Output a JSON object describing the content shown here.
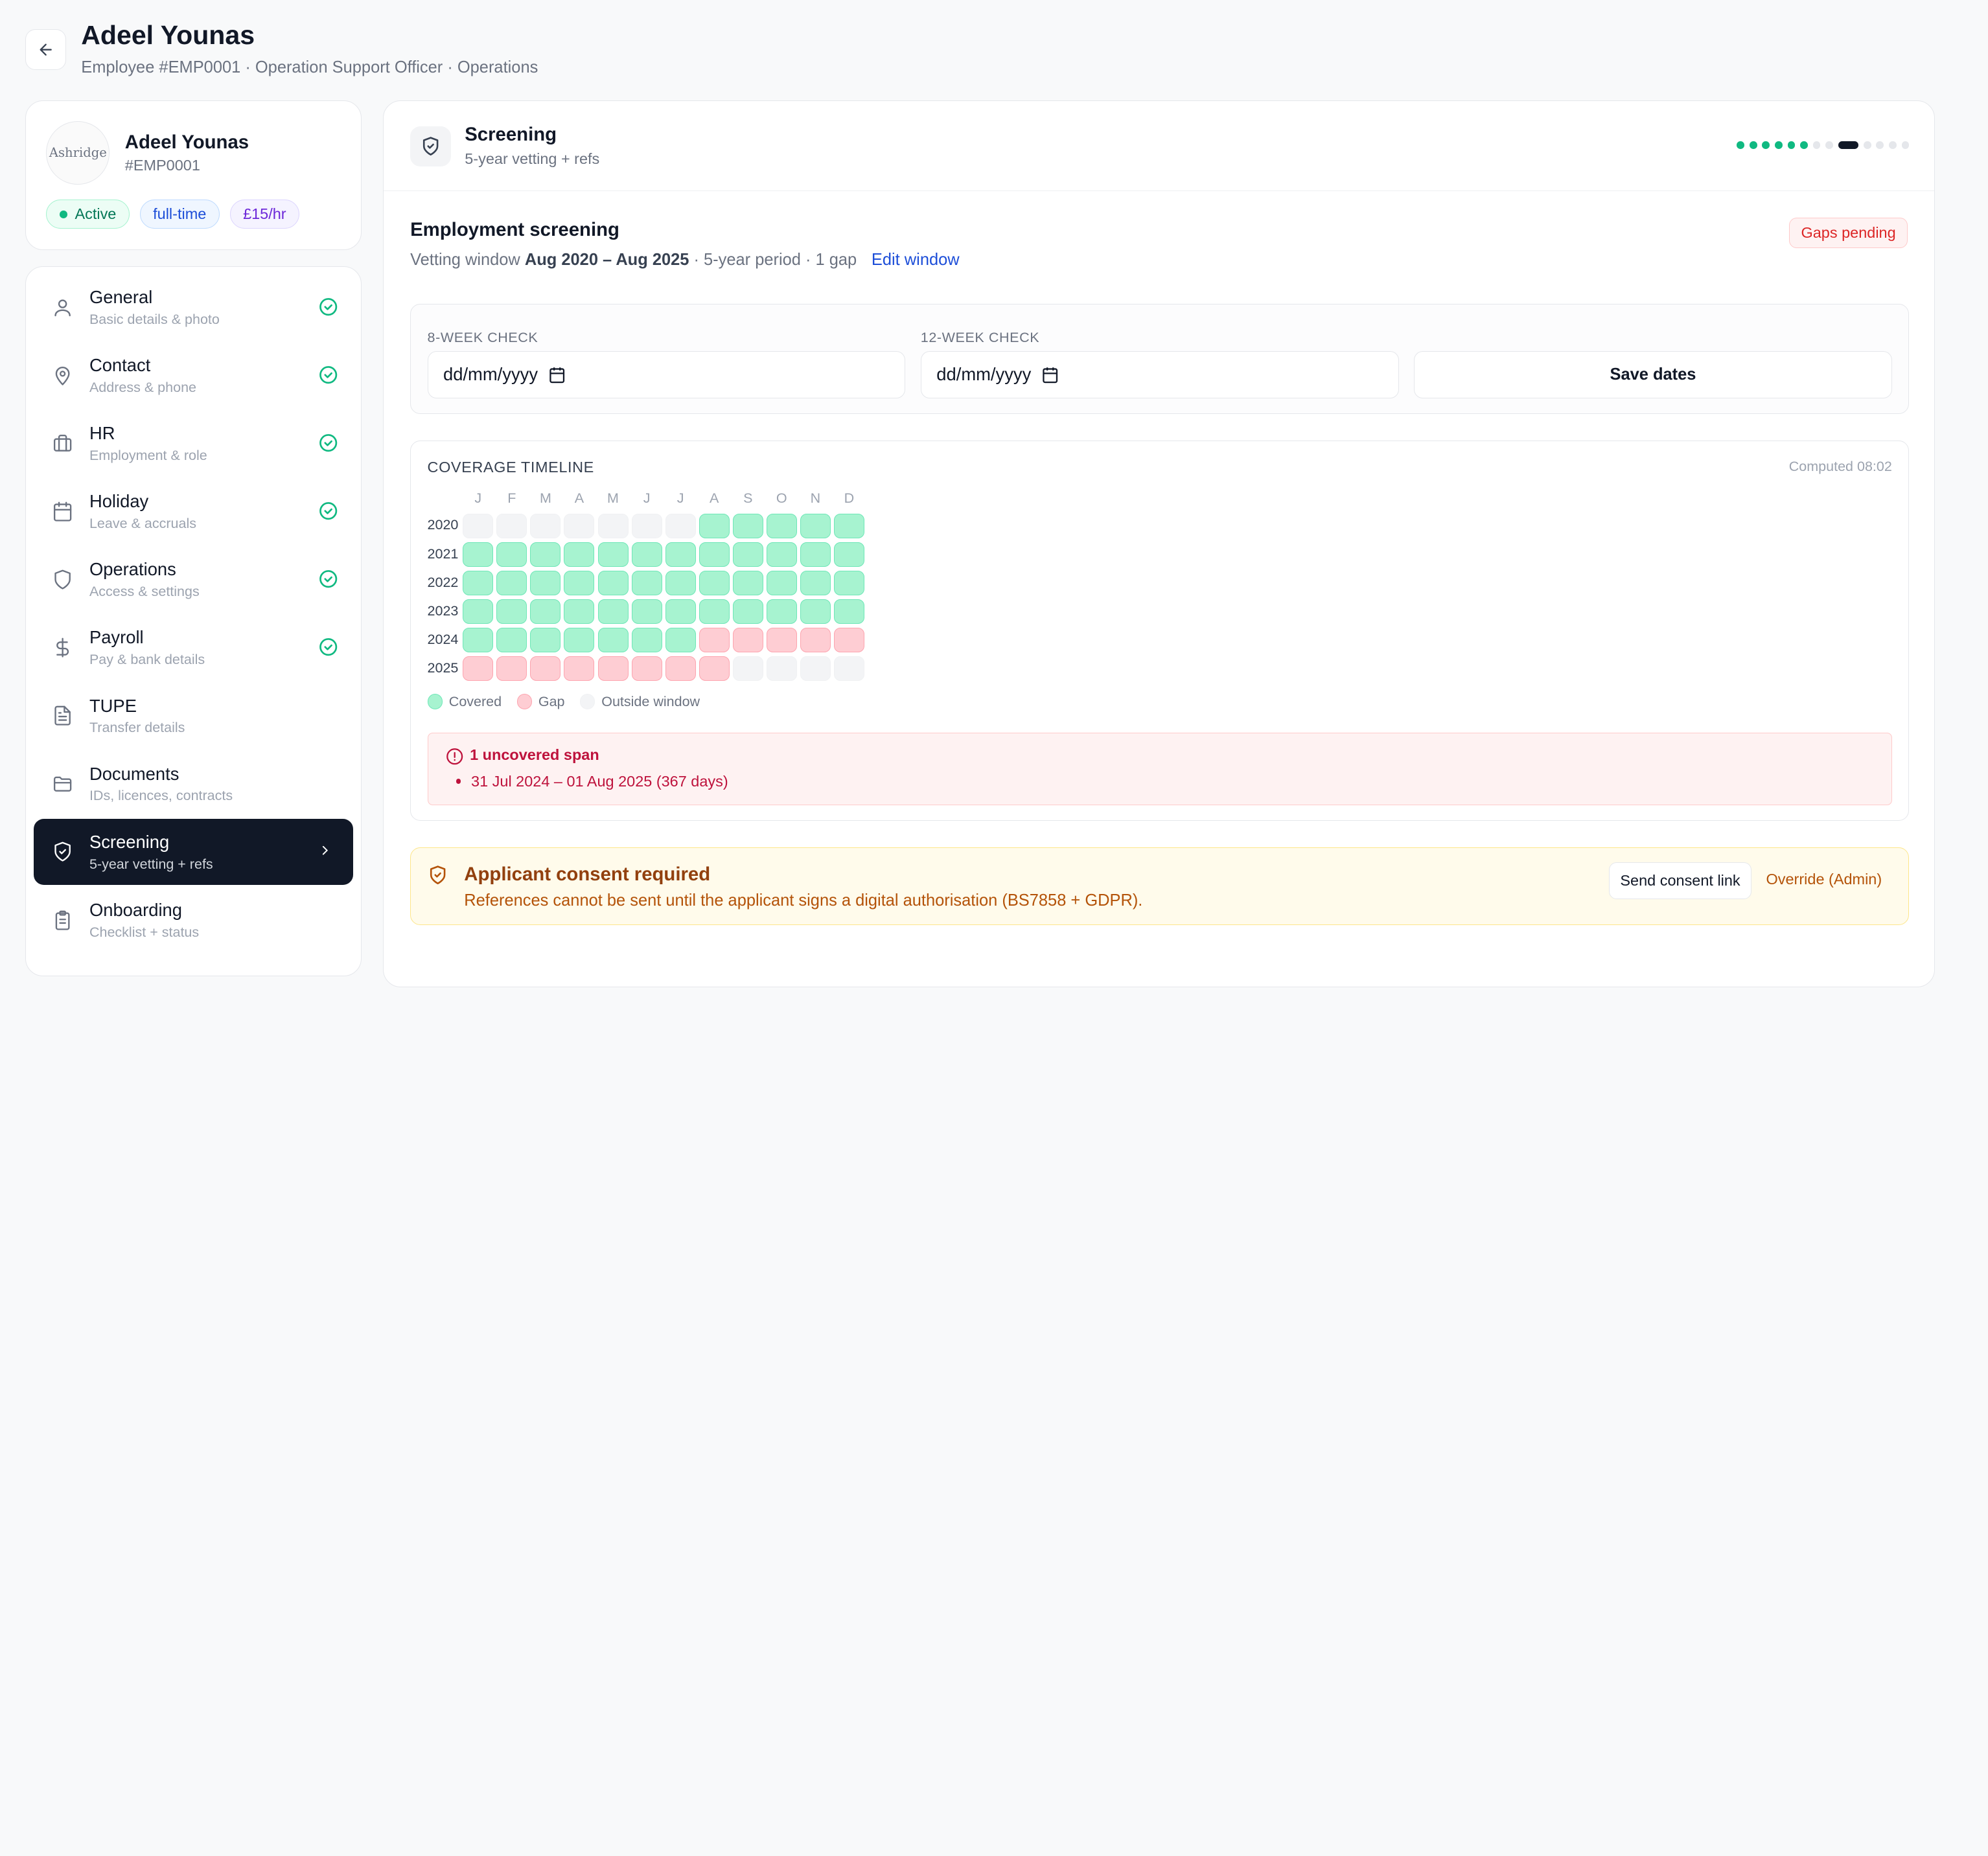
{
  "header": {
    "title": "Adeel Younas",
    "subtitle": "Employee #EMP0001 · Operation Support Officer · Operations"
  },
  "profile": {
    "logo_text": "Ashridge",
    "name": "Adeel Younas",
    "id": "#EMP0001",
    "badges": {
      "status": "Active",
      "type": "full-time",
      "rate": "£15/hr"
    }
  },
  "nav": {
    "items": [
      {
        "label": "General",
        "sub": "Basic details & photo",
        "icon": "user-icon",
        "done": true
      },
      {
        "label": "Contact",
        "sub": "Address & phone",
        "icon": "map-pin-icon",
        "done": true
      },
      {
        "label": "HR",
        "sub": "Employment & role",
        "icon": "briefcase-icon",
        "done": true
      },
      {
        "label": "Holiday",
        "sub": "Leave & accruals",
        "icon": "calendar-icon",
        "done": true
      },
      {
        "label": "Operations",
        "sub": "Access & settings",
        "icon": "shield-icon",
        "done": true
      },
      {
        "label": "Payroll",
        "sub": "Pay & bank details",
        "icon": "dollar-icon",
        "done": true
      },
      {
        "label": "TUPE",
        "sub": "Transfer details",
        "icon": "document-icon",
        "done": false
      },
      {
        "label": "Documents",
        "sub": "IDs, licences, contracts",
        "icon": "folder-icon",
        "done": false
      },
      {
        "label": "Screening",
        "sub": "5-year vetting + refs",
        "icon": "shield-check-icon",
        "done": false,
        "active": true
      },
      {
        "label": "Onboarding",
        "sub": "Checklist + status",
        "icon": "clipboard-icon",
        "done": false
      }
    ]
  },
  "screening": {
    "title": "Screening",
    "subtitle": "5-year vetting + refs",
    "steps": [
      "done",
      "done",
      "done",
      "done",
      "done",
      "done",
      "todo",
      "todo",
      "current",
      "todo",
      "todo",
      "todo",
      "todo"
    ]
  },
  "employment": {
    "title": "Employment screening",
    "window_prefix": "Vetting window",
    "window_range": "Aug 2020 – Aug 2025",
    "window_suffix": "· 5-year period · 1 gap",
    "edit_link": "Edit window",
    "gaps_badge": "Gaps pending"
  },
  "checks": {
    "week8_label": "8-WEEK CHECK",
    "week8_value": "dd/mm/yyyy",
    "week12_label": "12-WEEK CHECK",
    "week12_value": "dd/mm/yyyy",
    "save_label": "Save dates"
  },
  "timeline": {
    "title": "COVERAGE TIMELINE",
    "computed": "Computed 08:02",
    "months": [
      "J",
      "F",
      "M",
      "A",
      "M",
      "J",
      "J",
      "A",
      "S",
      "O",
      "N",
      "D"
    ],
    "years": [
      "2020",
      "2021",
      "2022",
      "2023",
      "2024",
      "2025"
    ],
    "rows": [
      [
        "o",
        "o",
        "o",
        "o",
        "o",
        "o",
        "o",
        "c",
        "c",
        "c",
        "c",
        "c"
      ],
      [
        "c",
        "c",
        "c",
        "c",
        "c",
        "c",
        "c",
        "c",
        "c",
        "c",
        "c",
        "c"
      ],
      [
        "c",
        "c",
        "c",
        "c",
        "c",
        "c",
        "c",
        "c",
        "c",
        "c",
        "c",
        "c"
      ],
      [
        "c",
        "c",
        "c",
        "c",
        "c",
        "c",
        "c",
        "c",
        "c",
        "c",
        "c",
        "c"
      ],
      [
        "c",
        "c",
        "c",
        "c",
        "c",
        "c",
        "c",
        "g",
        "g",
        "g",
        "g",
        "g"
      ],
      [
        "g",
        "g",
        "g",
        "g",
        "g",
        "g",
        "g",
        "g",
        "o",
        "o",
        "o",
        "o"
      ]
    ],
    "legend": {
      "covered": "Covered",
      "gap": "Gap",
      "outside": "Outside window"
    },
    "colors": {
      "covered": "#a7f3d0",
      "gap": "#fecdd3",
      "outside": "#f3f4f6"
    }
  },
  "uncovered": {
    "title": "1 uncovered span",
    "spans": [
      "31 Jul 2024 – 01 Aug 2025 (367 days)"
    ]
  },
  "consent": {
    "title": "Applicant consent required",
    "message": "References cannot be sent until the applicant signs a digital authorisation (BS7858 + GDPR).",
    "send_label": "Send consent link",
    "override_label": "Override (Admin)"
  }
}
